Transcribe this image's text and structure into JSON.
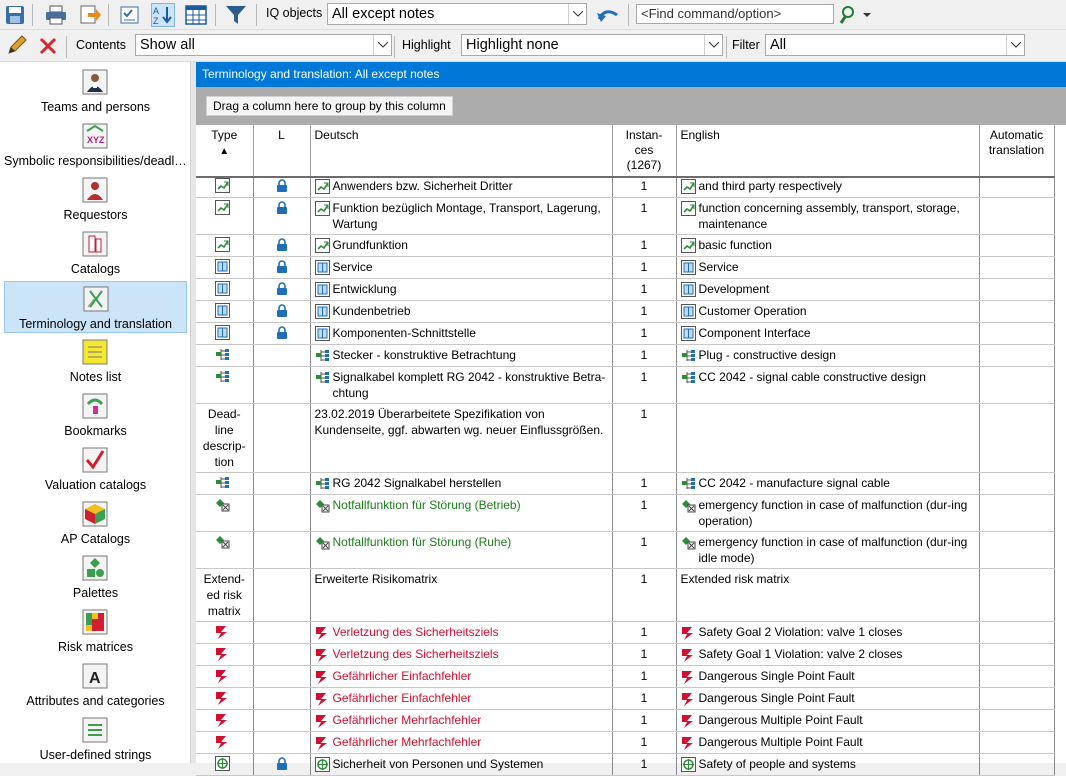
{
  "toolbar1": {
    "iq_objects_label": "IQ objects",
    "iq_objects_value": "All except notes",
    "find_placeholder": "<Find command/option>"
  },
  "toolbar2": {
    "contents_label": "Contents",
    "contents_value": "Show all",
    "highlight_label": "Highlight",
    "highlight_value": "Highlight none",
    "filter_label": "Filter",
    "filter_value": "All"
  },
  "sidebar": {
    "items": [
      {
        "label": "Teams and persons",
        "icon": "teams-icon"
      },
      {
        "label": "Symbolic responsibilities/deadlines",
        "icon": "symbolic-icon"
      },
      {
        "label": "Requestors",
        "icon": "requestor-icon"
      },
      {
        "label": "Catalogs",
        "icon": "catalog-icon"
      },
      {
        "label": "Terminology and translation",
        "icon": "terminology-icon",
        "active": true
      },
      {
        "label": "Notes list",
        "icon": "notes-icon"
      },
      {
        "label": "Bookmarks",
        "icon": "bookmark-icon"
      },
      {
        "label": "Valuation catalogs",
        "icon": "valuation-icon"
      },
      {
        "label": "AP Catalogs",
        "icon": "ap-catalog-icon"
      },
      {
        "label": "Palettes",
        "icon": "palette-icon"
      },
      {
        "label": "Risk matrices",
        "icon": "risk-matrix-icon"
      },
      {
        "label": "Attributes and categories",
        "icon": "attributes-icon"
      },
      {
        "label": "User-defined strings",
        "icon": "strings-icon"
      }
    ]
  },
  "panel": {
    "title": "Terminology and translation: All except notes",
    "group_hint": "Drag a column here to group by this column"
  },
  "grid": {
    "columns": {
      "type": "Type",
      "sort_indicator": "▲",
      "lock": "L",
      "deutsch": "Deutsch",
      "instances": "Instan-ces (1267)",
      "english": "English",
      "auto": "Automatic translation"
    },
    "rows": [
      {
        "kind": "function",
        "lock": true,
        "de": "Anwenders bzw. Sicherheit Dritter",
        "n": "1",
        "en": "and third party respectively",
        "trunc": true
      },
      {
        "kind": "function",
        "lock": true,
        "de": "Funktion bezüglich Montage, Transport, Lagerung, Wartung",
        "n": "1",
        "en": "function concerning assembly, transport, storage, maintenance"
      },
      {
        "kind": "function",
        "lock": true,
        "de": "Grundfunktion",
        "n": "1",
        "en": "basic function"
      },
      {
        "kind": "structure",
        "lock": true,
        "de": "Service",
        "n": "1",
        "en": "Service"
      },
      {
        "kind": "structure",
        "lock": true,
        "de": "Entwicklung",
        "n": "1",
        "en": "Development"
      },
      {
        "kind": "structure",
        "lock": true,
        "de": "Kundenbetrieb",
        "n": "1",
        "en": "Customer Operation"
      },
      {
        "kind": "structure",
        "lock": true,
        "de": "Komponenten-Schnittstelle",
        "n": "1",
        "en": "Component Interface"
      },
      {
        "kind": "tree",
        "lock": false,
        "de": "Stecker - konstruktive Betrachtung",
        "n": "1",
        "en": "Plug - constructive design"
      },
      {
        "kind": "tree",
        "lock": false,
        "de": "Signalkabel komplett RG 2042 - konstruktive Betra-chtung",
        "n": "1",
        "en": "CC 2042 - signal cable constructive design"
      },
      {
        "kind": "text",
        "type_text": "Dead-line descrip-tion",
        "lock": false,
        "de": "23.02.2019 Überarbeitete Spezifikation von Kundenseite, ggf. abwarten wg. neuer Einflussgrößen.",
        "n": "1",
        "en": ""
      },
      {
        "kind": "tree",
        "lock": false,
        "de": "RG 2042 Signalkabel herstellen",
        "n": "1",
        "en": "CC 2042 - manufacture signal cable"
      },
      {
        "kind": "emergency",
        "lock": false,
        "de": "Notfallfunktion für Störung (Betrieb)",
        "n": "1",
        "en": "emergency function in case of malfunction (dur-ing operation)",
        "color": "green"
      },
      {
        "kind": "emergency",
        "lock": false,
        "de": "Notfallfunktion für Störung (Ruhe)",
        "n": "1",
        "en": "emergency function in case of malfunction (dur-ing idle mode)",
        "color": "green"
      },
      {
        "kind": "text",
        "type_text": "Extend-ed risk matrix",
        "lock": false,
        "de": "Erweiterte Risikomatrix",
        "n": "1",
        "en": "Extended risk matrix"
      },
      {
        "kind": "failure",
        "lock": false,
        "de": "Verletzung des Sicherheitsziels",
        "n": "1",
        "en": "Safety Goal 2 Violation: valve 1 closes",
        "color": "red"
      },
      {
        "kind": "failure",
        "lock": false,
        "de": "Verletzung des Sicherheitsziels",
        "n": "1",
        "en": "Safety Goal 1 Violation: valve 2 closes",
        "color": "red"
      },
      {
        "kind": "failure",
        "lock": false,
        "de": "Gefährlicher Einfachfehler",
        "n": "1",
        "en": "Dangerous Single Point Fault",
        "color": "red"
      },
      {
        "kind": "failure",
        "lock": false,
        "de": "Gefährlicher Einfachfehler",
        "n": "1",
        "en": "Dangerous Single Point Fault",
        "color": "red"
      },
      {
        "kind": "failure",
        "lock": false,
        "de": "Gefährlicher Mehrfachfehler",
        "n": "1",
        "en": "Dangerous Multiple Point Fault",
        "color": "red"
      },
      {
        "kind": "failure",
        "lock": false,
        "de": "Gefährlicher Mehrfachfehler",
        "n": "1",
        "en": "Dangerous Multiple Point Fault",
        "color": "red"
      },
      {
        "kind": "safety",
        "lock": true,
        "de": "Sicherheit von Personen und Systemen",
        "n": "1",
        "en": "Safety of people and systems"
      }
    ]
  }
}
